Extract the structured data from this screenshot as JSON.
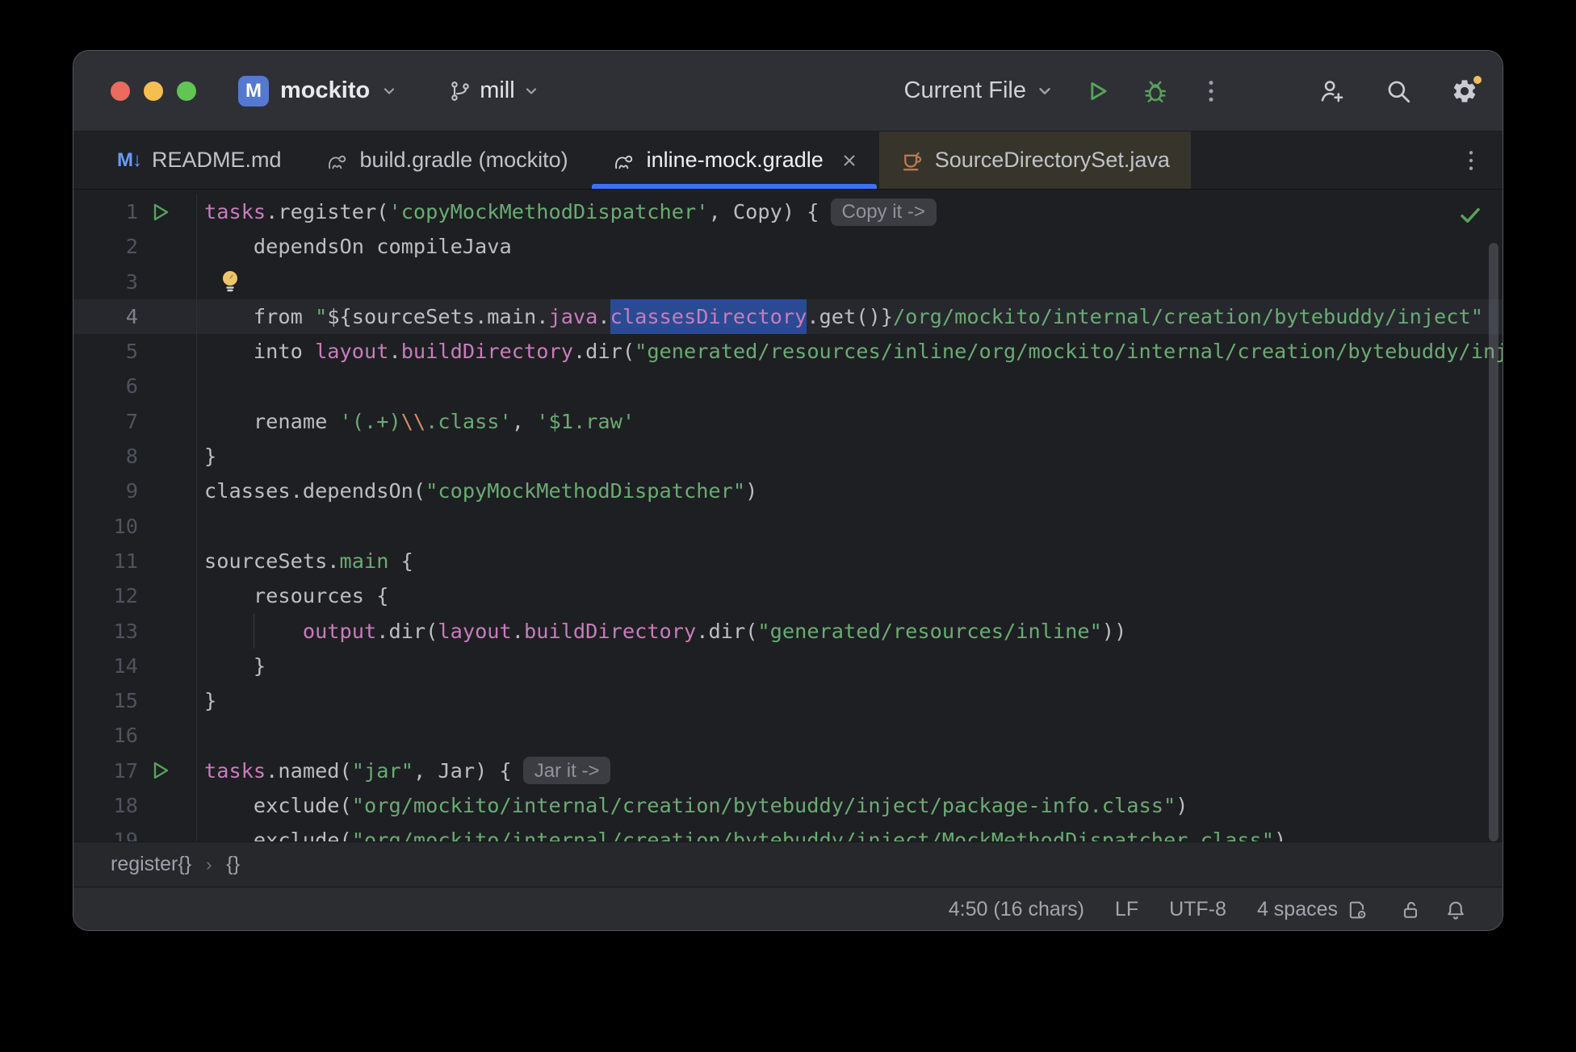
{
  "titlebar": {
    "project": {
      "initial": "M",
      "name": "mockito"
    },
    "branch": {
      "name": "mill"
    },
    "run_config": "Current File"
  },
  "tabs": [
    {
      "label": "README.md",
      "icon": "markdown",
      "icon_glyph": "M↓",
      "active": false
    },
    {
      "label": "build.gradle (mockito)",
      "icon": "gradle",
      "active": false
    },
    {
      "label": "inline-mock.gradle",
      "icon": "gradle",
      "active": true,
      "closable": true
    },
    {
      "label": "SourceDirectorySet.java",
      "icon": "java-class",
      "active": false,
      "highlighted": true
    }
  ],
  "editor": {
    "lines": [
      {
        "n": 1,
        "run": true,
        "inlay": "Copy it ->",
        "tokens": [
          {
            "t": "tasks",
            "c": "prop"
          },
          {
            "t": ".register(",
            "c": "fg"
          },
          {
            "t": "'copyMockMethodDispatcher'",
            "c": "str"
          },
          {
            "t": ", Copy) {",
            "c": "fg"
          }
        ]
      },
      {
        "n": 2,
        "tokens": [
          {
            "t": "    dependsOn compileJava",
            "c": "fg"
          }
        ]
      },
      {
        "n": 3,
        "bulb": true,
        "tokens": []
      },
      {
        "n": 4,
        "current": true,
        "tokens": [
          {
            "t": "    from ",
            "c": "fg"
          },
          {
            "t": "\"",
            "c": "str"
          },
          {
            "t": "${",
            "c": "fg"
          },
          {
            "t": "sourceSets.main.",
            "c": "fg"
          },
          {
            "t": "java",
            "c": "prop"
          },
          {
            "t": ".",
            "c": "fg"
          },
          {
            "t": "classesDirectory",
            "c": "prop",
            "sel": true
          },
          {
            "t": ".get()}",
            "c": "fg"
          },
          {
            "t": "/org/mockito/internal/creation/bytebuddy/inject\"",
            "c": "str"
          }
        ]
      },
      {
        "n": 5,
        "tokens": [
          {
            "t": "    into ",
            "c": "fg"
          },
          {
            "t": "layout",
            "c": "prop"
          },
          {
            "t": ".",
            "c": "fg"
          },
          {
            "t": "buildDirectory",
            "c": "prop"
          },
          {
            "t": ".dir(",
            "c": "fg"
          },
          {
            "t": "\"generated/resources/inline/org/mockito/internal/creation/bytebuddy/inject\"",
            "c": "str"
          },
          {
            "t": ")",
            "c": "fg"
          }
        ]
      },
      {
        "n": 6,
        "tokens": []
      },
      {
        "n": 7,
        "tokens": [
          {
            "t": "    rename ",
            "c": "fg"
          },
          {
            "t": "'(.+)",
            "c": "str"
          },
          {
            "t": "\\\\",
            "c": "esc"
          },
          {
            "t": ".class'",
            "c": "str"
          },
          {
            "t": ", ",
            "c": "fg"
          },
          {
            "t": "'$1.raw'",
            "c": "str"
          }
        ]
      },
      {
        "n": 8,
        "tokens": [
          {
            "t": "}",
            "c": "fg"
          }
        ]
      },
      {
        "n": 9,
        "tokens": [
          {
            "t": "classes.dependsOn(",
            "c": "fg"
          },
          {
            "t": "\"copyMockMethodDispatcher\"",
            "c": "str"
          },
          {
            "t": ")",
            "c": "fg"
          }
        ]
      },
      {
        "n": 10,
        "tokens": []
      },
      {
        "n": 11,
        "tokens": [
          {
            "t": "sourceSets.",
            "c": "fg"
          },
          {
            "t": "main",
            "c": "str"
          },
          {
            "t": " {",
            "c": "fg"
          }
        ]
      },
      {
        "n": 12,
        "tokens": [
          {
            "t": "    resources {",
            "c": "fg"
          }
        ]
      },
      {
        "n": 13,
        "guide": true,
        "tokens": [
          {
            "t": "        ",
            "c": "fg"
          },
          {
            "t": "output",
            "c": "prop"
          },
          {
            "t": ".dir(",
            "c": "fg"
          },
          {
            "t": "layout",
            "c": "prop"
          },
          {
            "t": ".",
            "c": "fg"
          },
          {
            "t": "buildDirectory",
            "c": "prop"
          },
          {
            "t": ".dir(",
            "c": "fg"
          },
          {
            "t": "\"generated/resources/inline\"",
            "c": "str"
          },
          {
            "t": "))",
            "c": "fg"
          }
        ]
      },
      {
        "n": 14,
        "tokens": [
          {
            "t": "    }",
            "c": "fg"
          }
        ]
      },
      {
        "n": 15,
        "tokens": [
          {
            "t": "}",
            "c": "fg"
          }
        ]
      },
      {
        "n": 16,
        "tokens": []
      },
      {
        "n": 17,
        "run": true,
        "inlay": "Jar it ->",
        "tokens": [
          {
            "t": "tasks",
            "c": "prop"
          },
          {
            "t": ".named(",
            "c": "fg"
          },
          {
            "t": "\"jar\"",
            "c": "str"
          },
          {
            "t": ", Jar) {",
            "c": "fg"
          }
        ]
      },
      {
        "n": 18,
        "tokens": [
          {
            "t": "    exclude(",
            "c": "fg"
          },
          {
            "t": "\"org/mockito/internal/creation/bytebuddy/inject/package-info.class\"",
            "c": "str"
          },
          {
            "t": ")",
            "c": "fg"
          }
        ]
      },
      {
        "n": 19,
        "tokens": [
          {
            "t": "    exclude(",
            "c": "fg"
          },
          {
            "t": "\"org/mockito/internal/creation/bytebuddy/inject/MockMethodDispatcher.class\"",
            "c": "str"
          },
          {
            "t": ")",
            "c": "fg"
          }
        ]
      }
    ]
  },
  "breadcrumbs": {
    "items": [
      "register{}",
      "{}"
    ],
    "separator": "›"
  },
  "status_bar": {
    "caret": "4:50 (16 chars)",
    "line_ending": "LF",
    "encoding": "UTF-8",
    "indent": "4 spaces"
  },
  "colors": {
    "accent_blue": "#3b74f1",
    "selection_blue": "#2b4a94",
    "string_green": "#6aab73",
    "property_pink": "#c77dbb",
    "escape_orange": "#cf8e6d",
    "run_green": "#57a25c",
    "notification_yellow": "#eec054",
    "editor_bg": "#1e1f22",
    "panel_bg": "#2b2d30",
    "java_tab_bg": "#37342b"
  }
}
